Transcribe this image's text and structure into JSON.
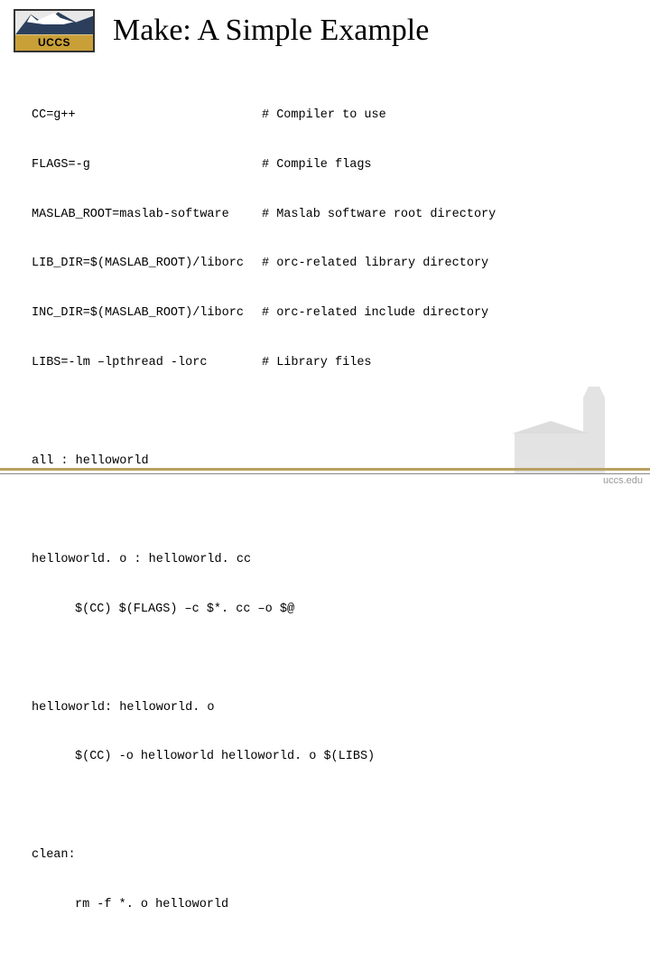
{
  "logo": {
    "text": "UCCS"
  },
  "title": "Make: A Simple Example",
  "vars": [
    {
      "def": "CC=g++",
      "comment": "# Compiler to use"
    },
    {
      "def": "FLAGS=-g",
      "comment": "# Compile flags"
    },
    {
      "def": "MASLAB_ROOT=maslab-software",
      "comment": "# Maslab software root directory"
    },
    {
      "def": "LIB_DIR=$(MASLAB_ROOT)/liborc",
      "comment": "# orc-related library directory"
    },
    {
      "def": "INC_DIR=$(MASLAB_ROOT)/liborc",
      "comment": "# orc-related include directory"
    },
    {
      "def": "LIBS=-lm –lpthread -lorc",
      "comment": "# Library files"
    }
  ],
  "targets": {
    "all": "all : helloworld",
    "obj_rule": "helloworld. o : helloworld. cc",
    "obj_cmd": "$(CC) $(FLAGS) –c $*. cc –o $@",
    "exe_rule": "helloworld: helloworld. o",
    "exe_cmd": "$(CC) -o helloworld helloworld. o $(LIBS)",
    "clean_rule": "clean:",
    "clean_cmd": "rm -f *. o helloworld"
  },
  "footer": {
    "url": "uccs.edu"
  }
}
